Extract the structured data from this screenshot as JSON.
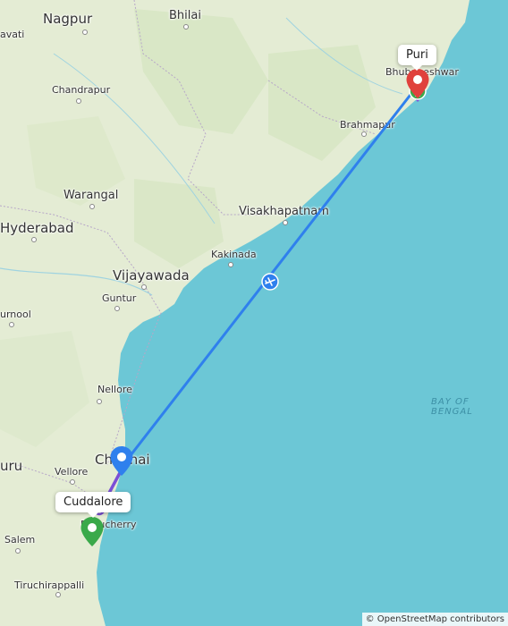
{
  "map": {
    "cities": [
      {
        "name": "Nagpur"
      },
      {
        "name": "Bhilai"
      },
      {
        "name": "avati"
      },
      {
        "name": "Chandrapur"
      },
      {
        "name": "Bhubaneshwar"
      },
      {
        "name": "Brahmapur"
      },
      {
        "name": "Warangal"
      },
      {
        "name": "Hyderabad"
      },
      {
        "name": "Visakhapatnam"
      },
      {
        "name": "Kakinada"
      },
      {
        "name": "Vijayawada"
      },
      {
        "name": "Guntur"
      },
      {
        "name": "urnool"
      },
      {
        "name": "Nellore"
      },
      {
        "name": "Chennai"
      },
      {
        "name": "uru"
      },
      {
        "name": "Vellore"
      },
      {
        "name": "Puducherry"
      },
      {
        "name": "Salem"
      },
      {
        "name": "Tiruchirappalli"
      }
    ],
    "sea_label": "BAY OF BENGAL",
    "origin_label": "Puri",
    "destination_label": "Cuddalore",
    "attribution": "© OpenStreetMap contributors",
    "colors": {
      "route": "#2f80ed",
      "route_secondary": "#7b4fd6",
      "origin_pin": "#e0413c",
      "destination_pin": "#3aa94a",
      "waypoint_pin": "#2f80ed",
      "land": "#e4ecd4",
      "water": "#6cc7d6"
    },
    "icons": {
      "flight": "airplane-icon",
      "origin": "red-pin-icon",
      "destination": "green-pin-icon",
      "chennai": "blue-pin-icon",
      "bus": "bus-icon"
    }
  }
}
